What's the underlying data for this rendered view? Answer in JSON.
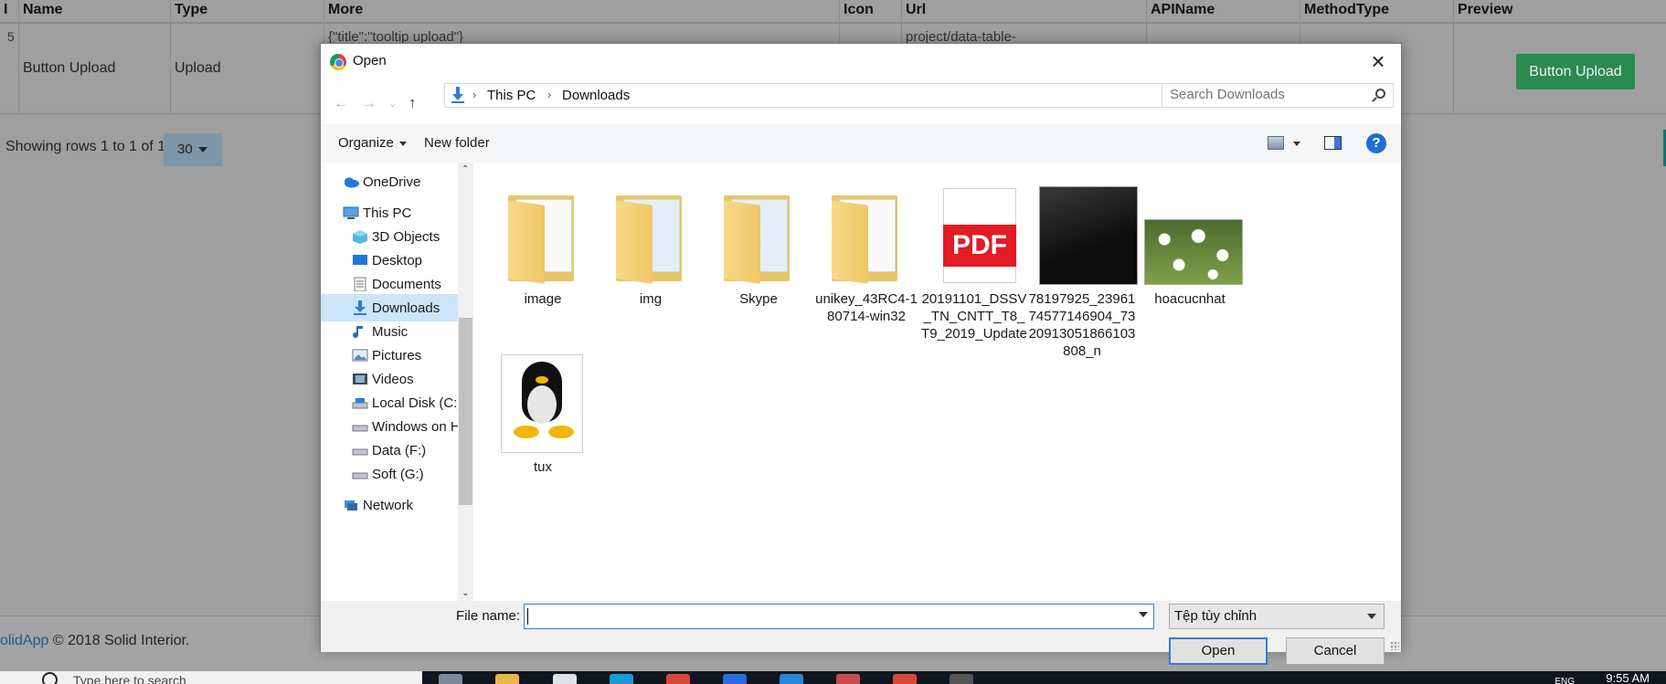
{
  "table": {
    "headers": [
      "I",
      "Name",
      "Type",
      "More",
      "Icon",
      "Url",
      "APIName",
      "MethodType",
      "Preview"
    ],
    "row": {
      "id": "5",
      "name": "Button Upload",
      "type": "Upload",
      "more": "{\"title\":\"tooltip upload\"}",
      "url": "project/data-table-",
      "preview_button": "Button Upload"
    },
    "rows_info": "Showing rows 1 to 1 of 1",
    "page_size": "30"
  },
  "footer": {
    "brand": "olidApp",
    "text": "© 2018 Solid Interior."
  },
  "dialog": {
    "title": "Open",
    "breadcrumb": [
      "This PC",
      "Downloads"
    ],
    "search_placeholder": "Search Downloads",
    "toolbar": {
      "organize": "Organize",
      "new_folder": "New folder",
      "help": "?"
    },
    "nav_items": [
      {
        "label": "OneDrive",
        "icon": "onedrive-icon"
      },
      {
        "label": "This PC",
        "icon": "this-pc-icon"
      },
      {
        "label": "3D Objects",
        "icon": "3d-objects-icon"
      },
      {
        "label": "Desktop",
        "icon": "desktop-icon"
      },
      {
        "label": "Documents",
        "icon": "documents-icon"
      },
      {
        "label": "Downloads",
        "icon": "downloads-icon",
        "selected": true
      },
      {
        "label": "Music",
        "icon": "music-icon"
      },
      {
        "label": "Pictures",
        "icon": "pictures-icon"
      },
      {
        "label": "Videos",
        "icon": "videos-icon"
      },
      {
        "label": "Local Disk (C:)",
        "icon": "drive-icon"
      },
      {
        "label": "Windows on HD",
        "icon": "drive-icon"
      },
      {
        "label": "Data (F:)",
        "icon": "drive-icon"
      },
      {
        "label": "Soft (G:)",
        "icon": "drive-icon"
      },
      {
        "label": "Network",
        "icon": "network-icon"
      }
    ],
    "files": [
      {
        "name": "image",
        "kind": "folder"
      },
      {
        "name": "img",
        "kind": "folder"
      },
      {
        "name": "Skype",
        "kind": "folder"
      },
      {
        "name": "unikey_43RC4-180714-win32",
        "kind": "folder"
      },
      {
        "name": "20191101_DSSV_TN_CNTT_T8_T9_2019_Update",
        "kind": "pdf"
      },
      {
        "name": "78197925_2396174577146904_7320913051866103808_n",
        "kind": "photo"
      },
      {
        "name": "hoacucnhat",
        "kind": "photo"
      },
      {
        "name": "tux",
        "kind": "image"
      }
    ],
    "pdf_label": "PDF",
    "file_name_label": "File name:",
    "file_name_value": "",
    "filter": "Tệp tùy chỉnh",
    "open_button": "Open",
    "cancel_button": "Cancel"
  },
  "taskbar": {
    "search_placeholder": "Type here to search",
    "lang": "ENG",
    "time": "9:55 AM"
  },
  "colors": {
    "accent": "#3a7bd5",
    "preview_button": "#2b8a4e",
    "pdf_red": "#e31b23",
    "selection": "#cce4f7"
  }
}
